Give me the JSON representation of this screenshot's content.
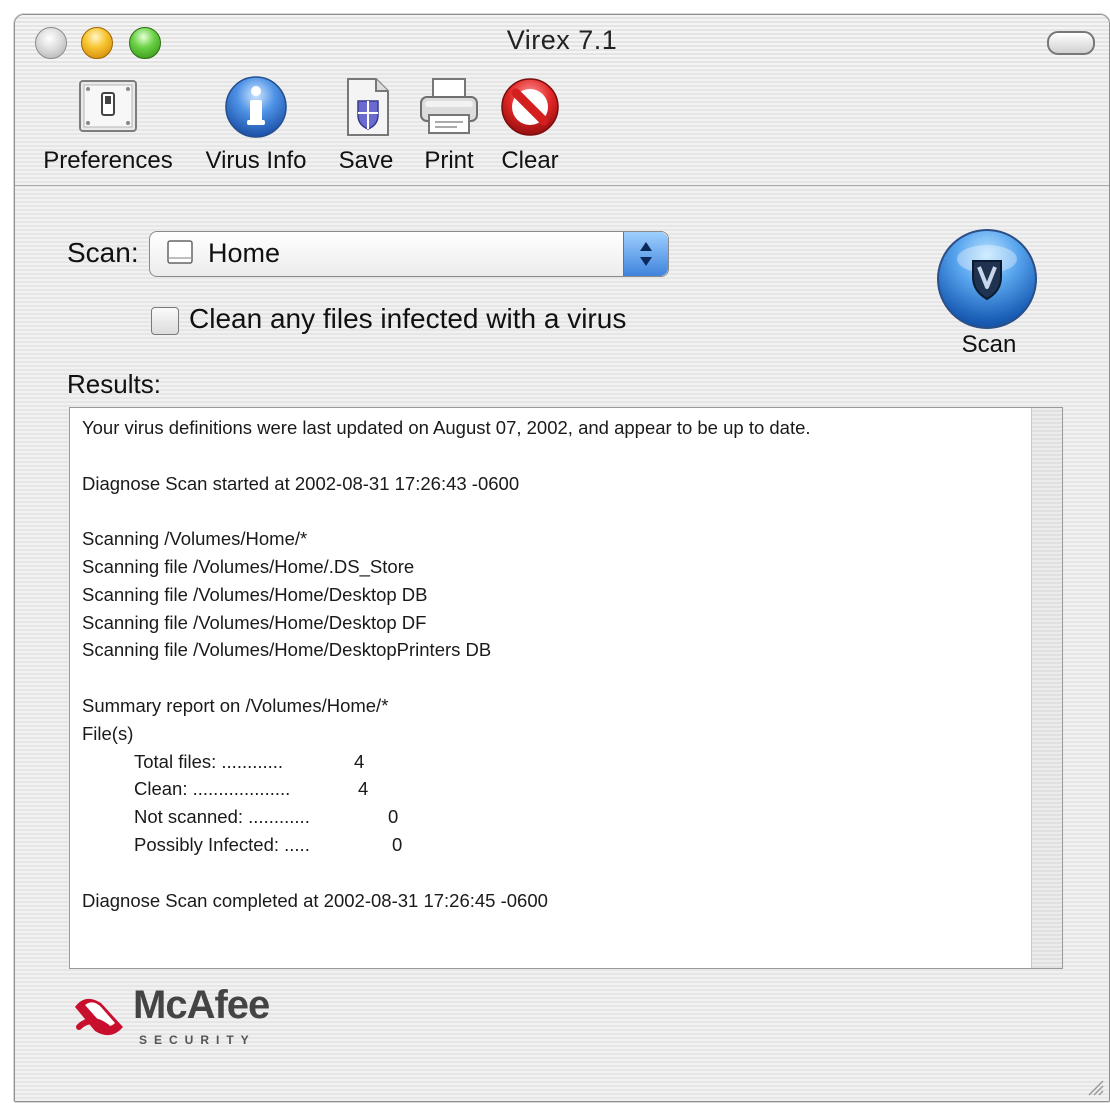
{
  "window": {
    "title": "Virex 7.1"
  },
  "toolbar": {
    "items": [
      {
        "label": "Preferences",
        "icon": "preferences-switch-icon"
      },
      {
        "label": "Virus Info",
        "icon": "info-icon"
      },
      {
        "label": "Save",
        "icon": "save-document-icon"
      },
      {
        "label": "Print",
        "icon": "printer-icon"
      },
      {
        "label": "Clear",
        "icon": "clear-prohibit-icon"
      }
    ]
  },
  "scan": {
    "label": "Scan:",
    "selected": "Home",
    "clean_option": {
      "label": "Clean any files infected with a virus",
      "checked": false
    },
    "button_label": "Scan"
  },
  "results": {
    "label": "Results:",
    "lines": [
      "Your virus definitions were last updated on August 07, 2002, and appear to be up to date.",
      "",
      "Diagnose Scan started at 2002-08-31 17:26:43 -0600",
      "",
      "Scanning /Volumes/Home/*",
      "Scanning file /Volumes/Home/.DS_Store",
      "Scanning file /Volumes/Home/Desktop DB",
      "Scanning file /Volumes/Home/Desktop DF",
      "Scanning file /Volumes/Home/DesktopPrinters DB",
      "",
      "Summary report on /Volumes/Home/*",
      "File(s)"
    ],
    "summary": [
      {
        "label": "Total files: ............",
        "value": "4"
      },
      {
        "label": "Clean: ...................",
        "value": "4"
      },
      {
        "label": "Not scanned: ............",
        "value": "0"
      },
      {
        "label": "Possibly Infected: .....",
        "value": "0"
      }
    ],
    "footer_line": "Diagnose Scan completed at 2002-08-31 17:26:45 -0600"
  },
  "branding": {
    "name": "McAfee",
    "tagline": "SECURITY"
  },
  "colors": {
    "accent_blue": "#3f83dc",
    "clear_red": "#d41f1f",
    "logo_red": "#c8102e"
  }
}
